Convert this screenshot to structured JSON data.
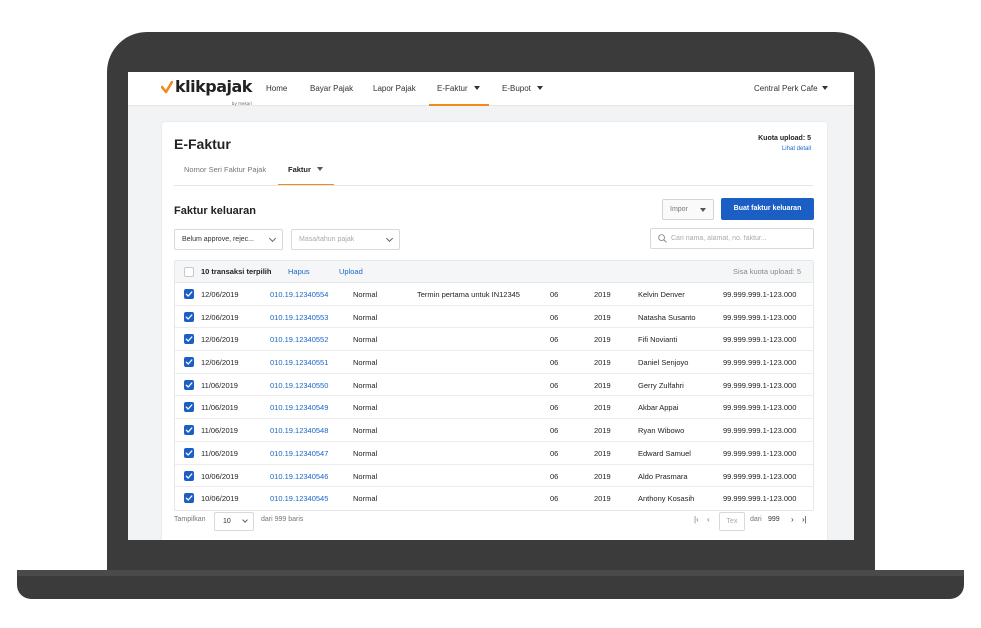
{
  "brand": {
    "name": "klikpajak",
    "sub": "by mekari",
    "accent": "#ef8a1d",
    "primary": "#1c5fc4"
  },
  "nav": {
    "items": [
      {
        "label": "Home"
      },
      {
        "label": "Bayar Pajak"
      },
      {
        "label": "Lapor Pajak"
      },
      {
        "label": "E-Faktur",
        "active": true,
        "dropdown": true
      },
      {
        "label": "E-Bupot",
        "dropdown": true
      }
    ],
    "company": "Central Perk Cafe"
  },
  "page": {
    "title": "E-Faktur",
    "quota_label": "Kuota upload: 5",
    "quota_link": "Lihat detail",
    "subtabs": [
      {
        "label": "Nomor Seri Faktur Pajak"
      },
      {
        "label": "Faktur",
        "active": true
      }
    ]
  },
  "section": {
    "title": "Faktur keluaran",
    "impor_label": "Impor",
    "create_label": "Buat faktur keluaran",
    "filter_status": "Belum approve, rejec...",
    "filter_period_placeholder": "Masa/tahun pajak",
    "search_placeholder": "Cari nama, alamat, no. faktur..."
  },
  "table": {
    "selected_count": "10 transaksi terpilih",
    "delete_label": "Hapus",
    "upload_label": "Upload",
    "remaining": "Sisa kuota upload: 5",
    "rows": [
      {
        "date": "12/06/2019",
        "no": "010.19.12340554",
        "type": "Normal",
        "note": "Termin pertama untuk IN12345",
        "month": "06",
        "year": "2019",
        "name": "Kelvin Denver",
        "npwp": "99.999.999.1-123.000"
      },
      {
        "date": "12/06/2019",
        "no": "010.19.12340553",
        "type": "Normal",
        "note": "",
        "month": "06",
        "year": "2019",
        "name": "Natasha Susanto",
        "npwp": "99.999.999.1-123.000"
      },
      {
        "date": "12/06/2019",
        "no": "010.19.12340552",
        "type": "Normal",
        "note": "",
        "month": "06",
        "year": "2019",
        "name": "Fifi Novianti",
        "npwp": "99.999.999.1-123.000"
      },
      {
        "date": "12/06/2019",
        "no": "010.19.12340551",
        "type": "Normal",
        "note": "",
        "month": "06",
        "year": "2019",
        "name": "Daniel Senjoyo",
        "npwp": "99.999.999.1-123.000"
      },
      {
        "date": "11/06/2019",
        "no": "010.19.12340550",
        "type": "Normal",
        "note": "",
        "month": "06",
        "year": "2019",
        "name": "Gerry Zulfahri",
        "npwp": "99.999.999.1-123.000"
      },
      {
        "date": "11/06/2019",
        "no": "010.19.12340549",
        "type": "Normal",
        "note": "",
        "month": "06",
        "year": "2019",
        "name": "Akbar Appai",
        "npwp": "99.999.999.1-123.000"
      },
      {
        "date": "11/06/2019",
        "no": "010.19.12340548",
        "type": "Normal",
        "note": "",
        "month": "06",
        "year": "2019",
        "name": "Ryan Wibowo",
        "npwp": "99.999.999.1-123.000"
      },
      {
        "date": "11/06/2019",
        "no": "010.19.12340547",
        "type": "Normal",
        "note": "",
        "month": "06",
        "year": "2019",
        "name": "Edward Samuel",
        "npwp": "99.999.999.1-123.000"
      },
      {
        "date": "10/06/2019",
        "no": "010.19.12340546",
        "type": "Normal",
        "note": "",
        "month": "06",
        "year": "2019",
        "name": "Aldo Prasmara",
        "npwp": "99.999.999.1-123.000"
      },
      {
        "date": "10/06/2019",
        "no": "010.19.12340545",
        "type": "Normal",
        "note": "",
        "month": "06",
        "year": "2019",
        "name": "Anthony Kosasih",
        "npwp": "99.999.999.1-123.000"
      }
    ]
  },
  "footer": {
    "show_label": "Tampilkan",
    "page_size": "10",
    "total": "dari 999 baris",
    "page_placeholder": "Tex",
    "of_label": "dari",
    "total_pages": "999"
  }
}
